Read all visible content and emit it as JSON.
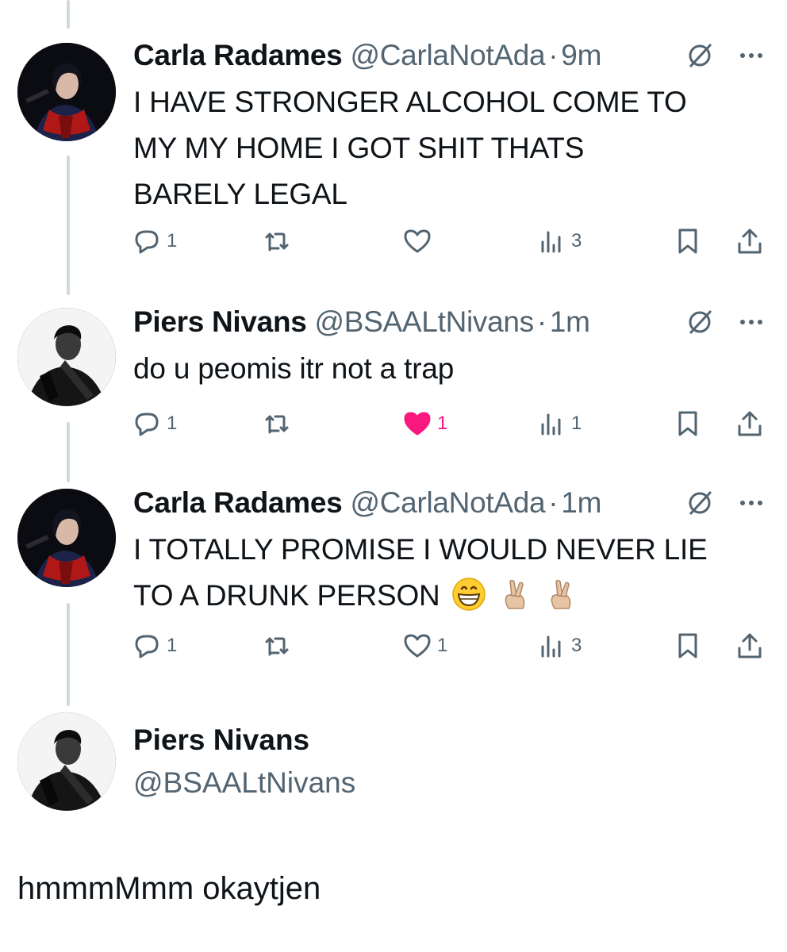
{
  "tweets": [
    {
      "name": "Carla Radames",
      "handle": "@CarlaNotAda",
      "separator": "·",
      "time": "9m",
      "lines": [
        "I HAVE STRONGER ALCOHOL COME TO",
        "MY MY HOME I GOT SHIT THATS",
        "BARELY LEGAL"
      ],
      "replies": "1",
      "retweets": "",
      "likes": "",
      "views": "3"
    },
    {
      "name": "Piers Nivans",
      "handle": "@BSAALtNivans",
      "separator": "·",
      "time": "1m",
      "lines": [
        "do u peomis itr not a trap"
      ],
      "replies": "1",
      "retweets": "",
      "likes": "1",
      "liked": true,
      "views": "1"
    },
    {
      "name": "Carla Radames",
      "handle": "@CarlaNotAda",
      "separator": "·",
      "time": "1m",
      "lines": [
        "I TOTALLY PROMISE I WOULD NEVER LIE",
        "TO A DRUNK PERSON"
      ],
      "emojis": [
        "grinning-face",
        "crossed-fingers",
        "crossed-fingers"
      ],
      "replies": "1",
      "retweets": "",
      "likes": "1",
      "views": "3"
    }
  ],
  "focused": {
    "name": "Piers Nivans",
    "handle": "@BSAALtNivans",
    "text": "hmmmMmm okaytjen"
  },
  "icons": [
    "reply-icon",
    "retweet-icon",
    "like-icon",
    "views-icon",
    "bookmark-icon",
    "share-icon",
    "edited-icon",
    "more-icon"
  ],
  "colors": {
    "text": "#0f1419",
    "secondary": "#536471",
    "like": "#f91880",
    "thread_line": "#cfd9de"
  }
}
